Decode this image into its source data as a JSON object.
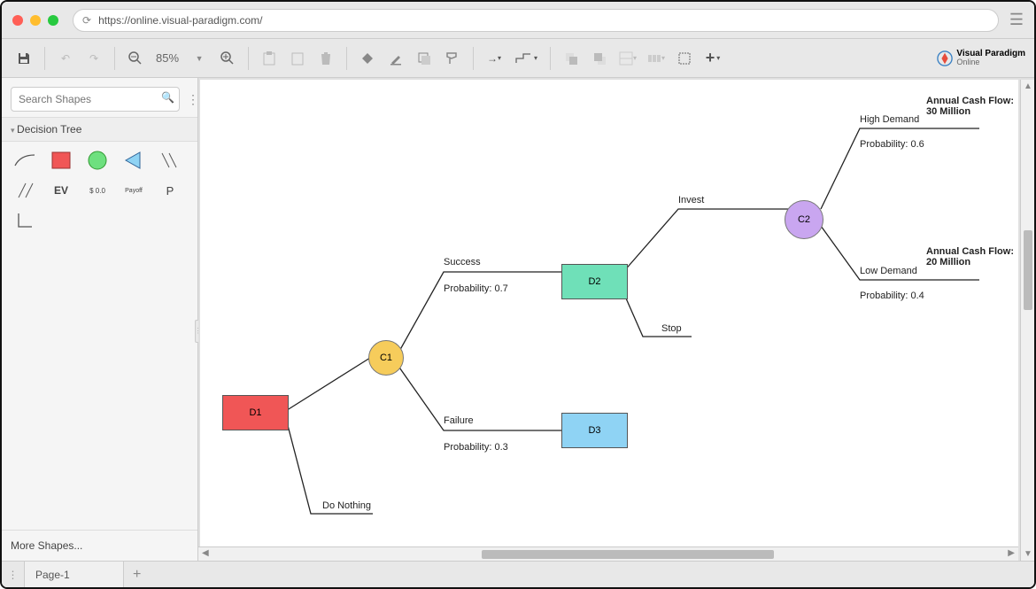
{
  "url": "https://online.visual-paradigm.com/",
  "toolbar": {
    "zoom": "85%",
    "brand_line1": "Visual Paradigm",
    "brand_line2": "Online"
  },
  "sidebar": {
    "search_placeholder": "Search Shapes",
    "palette_title": "Decision Tree",
    "ev": "EV",
    "price": "$ 0.0",
    "payoff": "Payoff",
    "p": "P",
    "more_shapes": "More Shapes..."
  },
  "pages": {
    "tab1": "Page-1"
  },
  "diagram": {
    "nodes": {
      "d1": "D1",
      "d2": "D2",
      "d3": "D3",
      "c1": "C1",
      "c2": "C2"
    },
    "labels": {
      "success": "Success",
      "prob_success": "Probability: 0.7",
      "failure": "Failure",
      "prob_failure": "Probability: 0.3",
      "do_nothing": "Do Nothing",
      "invest": "Invest",
      "stop": "Stop",
      "high": "High Demand",
      "prob_high": "Probability: 0.6",
      "cash_high": "Annual Cash Flow: 30 Million",
      "low": "Low Demand",
      "prob_low": "Probability: 0.4",
      "cash_low": "Annual Cash Flow: 20 Million"
    }
  }
}
